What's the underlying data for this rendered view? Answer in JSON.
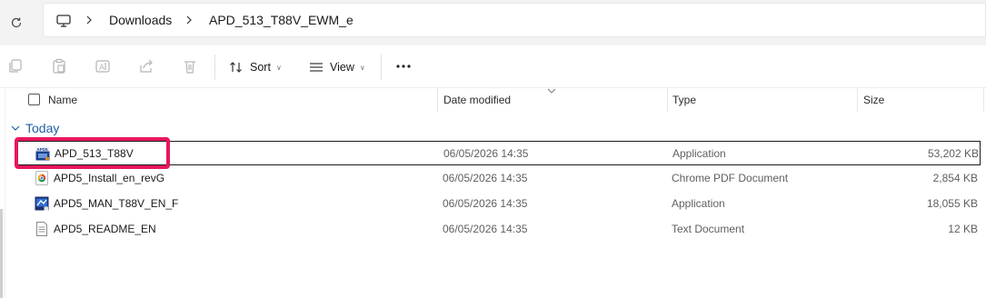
{
  "address": {
    "refresh_icon": "refresh-icon",
    "pc_icon": "this-pc-icon",
    "crumbs": [
      "Downloads",
      "APD_513_T88V_EWM_e"
    ]
  },
  "toolbar": {
    "icons": [
      "copy-icon",
      "paste-icon",
      "rename-icon",
      "share-icon",
      "delete-icon"
    ],
    "sort_label": "Sort",
    "view_label": "View",
    "more_icon": "more-options-icon"
  },
  "columns": {
    "name": "Name",
    "date": "Date modified",
    "type": "Type",
    "size": "Size"
  },
  "group": {
    "label": "Today"
  },
  "files": [
    {
      "name": "APD_513_T88V",
      "date": "06/05/2026 14:35",
      "type": "Application",
      "size": "53,202 KB",
      "icon": "apd-application-icon",
      "selected": true
    },
    {
      "name": "APD5_Install_en_revG",
      "date": "06/05/2026 14:35",
      "type": "Chrome PDF Document",
      "size": "2,854 KB",
      "icon": "chrome-pdf-icon",
      "selected": false
    },
    {
      "name": "APD5_MAN_T88V_EN_F",
      "date": "06/05/2026 14:35",
      "type": "Application",
      "size": "18,055 KB",
      "icon": "application-icon",
      "selected": false
    },
    {
      "name": "APD5_README_EN",
      "date": "06/05/2026 14:35",
      "type": "Text Document",
      "size": "12 KB",
      "icon": "text-document-icon",
      "selected": false
    }
  ],
  "colors": {
    "highlight": "#e8175d",
    "group_label": "#1f5fa6"
  }
}
